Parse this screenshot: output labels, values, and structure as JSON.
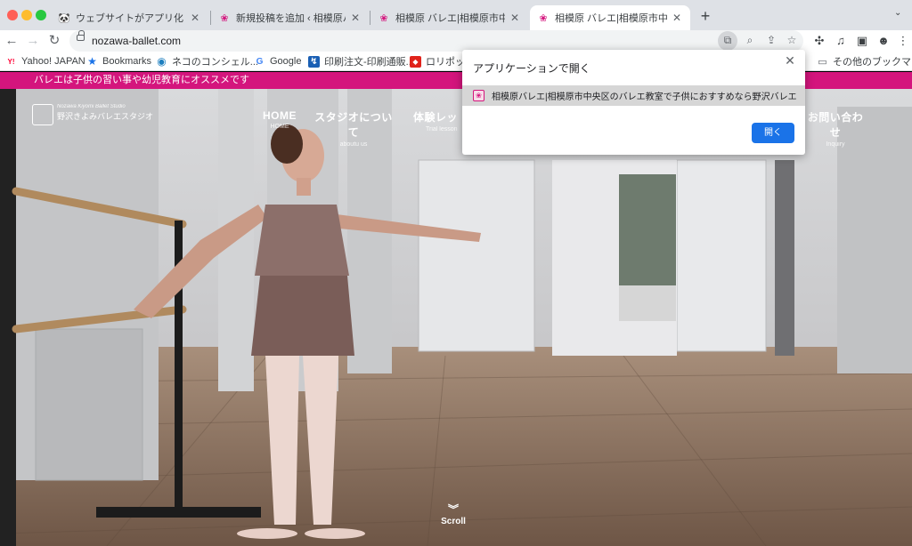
{
  "tabs": [
    {
      "title": "ウェブサイトがアプリ化！PWA",
      "icon": "panda-favicon-icon"
    },
    {
      "title": "新規投稿を追加 ‹ 相模原バレエ|",
      "icon": "ballet-favicon-icon"
    },
    {
      "title": "相模原 バレエ|相模原市中央区の",
      "icon": "ballet-favicon-icon"
    },
    {
      "title": "相模原 バレエ|相模原市中央区の",
      "icon": "ballet-favicon-icon"
    }
  ],
  "toolbar": {
    "url": "nozawa-ballet.com"
  },
  "bookmarks": [
    {
      "label": "Yahoo! JAPAN",
      "icon": "yahoo-icon",
      "glyph": "Y!"
    },
    {
      "label": "Bookmarks",
      "icon": "star-icon",
      "glyph": "★"
    },
    {
      "label": "ネコのコンシェル...",
      "icon": "neko-icon",
      "glyph": "◉"
    },
    {
      "label": "Google",
      "icon": "google-icon",
      "glyph": "G"
    },
    {
      "label": "印刷注文-印刷通販...",
      "icon": "print-icon",
      "glyph": "↯"
    },
    {
      "label": "ロリポッ",
      "icon": "lolipop-icon",
      "glyph": "◆"
    }
  ],
  "other_bookmarks": "その他のブックマーク",
  "page": {
    "banner": "バレエは子供の習い事や幼児教育にオススメです",
    "logo_script": "Nozawa Kiyomi Ballet Studio",
    "logo_name": "野沢きよみバレエスタジオ",
    "nav": [
      {
        "main": "HOME",
        "sub": "HOME"
      },
      {
        "main": "スタジオについて",
        "sub": "aboutu us"
      },
      {
        "main": "体験レッ",
        "sub": "Trial lesson"
      },
      {
        "main": "お問い合わせ",
        "sub": "Inquiry"
      }
    ],
    "scroll_label": "Scroll"
  },
  "popup": {
    "title": "アプリケーションで開く",
    "app_name": "相模原バレエ|相模原市中央区のバレエ教室で子供におすすめなら野沢バレエ",
    "open_button": "開く"
  },
  "colors": {
    "banner": "#d4157d",
    "button": "#1a73e8"
  }
}
